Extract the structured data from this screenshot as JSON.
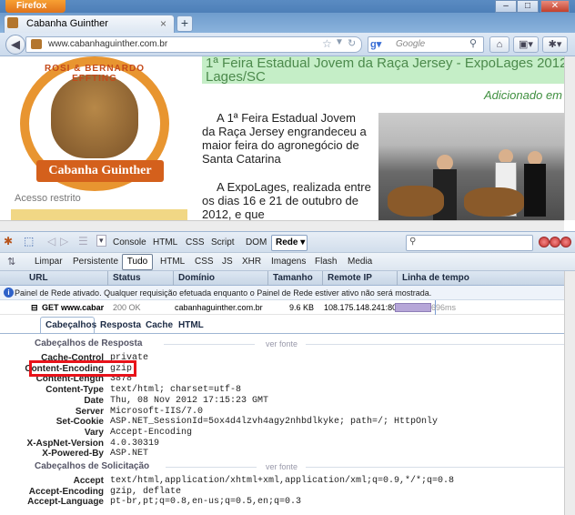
{
  "browser": {
    "app_button": "Firefox",
    "tab_title": "Cabanha Guinther",
    "tab_close": "×",
    "new_tab": "+",
    "url": "www.cabanhaguinther.com.br",
    "search_placeholder": "Google",
    "window_controls": [
      "–",
      "□",
      "✕"
    ]
  },
  "page": {
    "logo_top_text": "ROSI & BERNARDO EFFTING",
    "logo_banner": "Cabanha Guinther",
    "acesso_restrito": "Acesso restrito",
    "headline_line1": "1ª Feira Estadual Jovem da Raça Jersey - ExpoLages 2012",
    "headline_line2": "Lages/SC",
    "added": "Adicionado em",
    "para1": "A 1ª Feira Estadual Jovem da Raça Jersey engrandeceu a maior feira do agronegócio de Santa Catarina",
    "para2": "A ExpoLages, realizada entre os dias 16 e 21 de outubro de 2012, e que"
  },
  "devtools": {
    "tabs": [
      "Console",
      "HTML",
      "CSS",
      "Script",
      "DOM"
    ],
    "active_tab": "Rede",
    "filters": [
      "Limpar",
      "Persistente",
      "Tudo",
      "HTML",
      "CSS",
      "JS",
      "XHR",
      "Imagens",
      "Flash",
      "Media"
    ],
    "columns": [
      "URL",
      "Status",
      "Domínio",
      "Tamanho",
      "Remote IP",
      "Linha de tempo"
    ],
    "notice": "Painel de Rede ativado. Qualquer requisição efetuada enquanto o Painel de Rede estiver ativo não será mostrada.",
    "request": {
      "method_url": "GET www.cabar",
      "status": "200 OK",
      "domain": "cabanhaguinther.com.br",
      "size": "9.6 KB",
      "remote_ip": "108.175.148.241:80",
      "time": "696ms"
    },
    "subtabs": [
      "Cabeçalhos",
      "Resposta",
      "Cache",
      "HTML"
    ],
    "response_section": "Cabeçalhos de Resposta",
    "request_section": "Cabeçalhos de Solicitação",
    "view_source": "ver fonte",
    "response_headers": [
      {
        "k": "Cache-Control",
        "v": "private"
      },
      {
        "k": "Content-Encoding",
        "v": "gzip"
      },
      {
        "k": "Content-Length",
        "v": "3878"
      },
      {
        "k": "Content-Type",
        "v": "text/html; charset=utf-8"
      },
      {
        "k": "Date",
        "v": "Thu, 08 Nov 2012 17:15:23 GMT"
      },
      {
        "k": "Server",
        "v": "Microsoft-IIS/7.0"
      },
      {
        "k": "Set-Cookie",
        "v": "ASP.NET_SessionId=5ox4d4lzvh4agy2nhbdlkyke; path=/; HttpOnly"
      },
      {
        "k": "Vary",
        "v": "Accept-Encoding"
      },
      {
        "k": "X-AspNet-Version",
        "v": "4.0.30319"
      },
      {
        "k": "X-Powered-By",
        "v": "ASP.NET"
      }
    ],
    "request_headers": [
      {
        "k": "Accept",
        "v": "text/html,application/xhtml+xml,application/xml;q=0.9,*/*;q=0.8"
      },
      {
        "k": "Accept-Encoding",
        "v": "gzip, deflate"
      },
      {
        "k": "Accept-Language",
        "v": "pt-br,pt;q=0.8,en-us;q=0.5,en;q=0.3"
      }
    ]
  }
}
